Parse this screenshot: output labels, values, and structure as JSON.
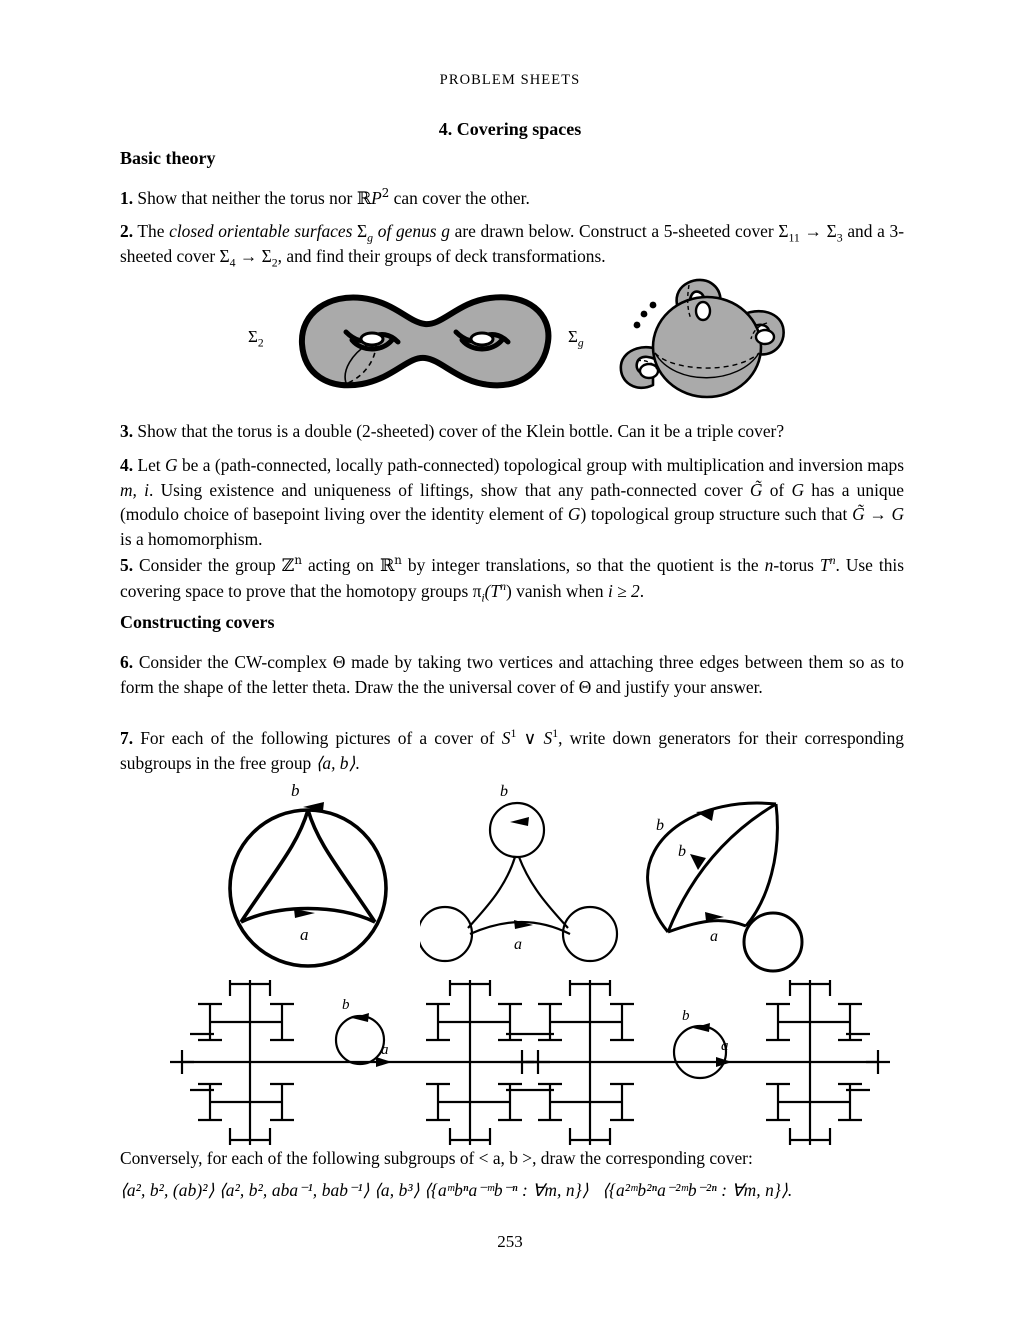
{
  "document": {
    "running_head": "PROBLEM SHEETS",
    "section_title": "4. Covering spaces",
    "page_number": "253"
  },
  "headings": {
    "basic_theory": "Basic theory",
    "constructing_covers": "Constructing covers"
  },
  "problems": {
    "p1": {
      "number": "1.",
      "text_a": "Show that neither the torus nor ",
      "math_rp2": "RP",
      "sup_2": "2",
      "text_b": " can cover the other."
    },
    "p2": {
      "number": "2.",
      "text_a": "The ",
      "italic_a": "closed orientable surfaces",
      "sigma": "Σ",
      "sub_g": "g",
      "italic_b": "of genus",
      "g": "g",
      "text_b": " are drawn below.  Construct a 5-sheeted cover ",
      "sigma11": "Σ",
      "sub_11": "11",
      "arrow": "→",
      "sigma3": "Σ",
      "sub_3": "3",
      "text_c": " and a 3-sheeted cover ",
      "sigma4": "Σ",
      "sub_4": "4",
      "sigma2": "Σ",
      "sub_2": "2",
      "text_d": ", and find their groups of deck transformations."
    },
    "p3": {
      "number": "3.",
      "text": "Show that the torus is a double (2-sheeted) cover of the Klein bottle.  Can it be a triple cover?"
    },
    "p4": {
      "number": "4.",
      "text_a": "Let ",
      "G": "G",
      "text_b": " be a (path-connected, locally path-connected) topological group with multiplication and inversion maps ",
      "m_i": "m, i",
      "text_c": ". Using existence and uniqueness of liftings, show that any path-connected cover ",
      "Gtilde": "G̃",
      "text_d": " of ",
      "G2": "G",
      "text_e": " has a unique (modulo choice of basepoint living over the identity element of ",
      "G3": "G",
      "text_f": ") topological group structure such that ",
      "Gtilde2": "G̃",
      "arrow": " → ",
      "G4": "G",
      "text_g": " is a homomorphism."
    },
    "p5": {
      "number": "5.",
      "text_a": "Consider the group ",
      "Zn": "Z",
      "sup_n1": "n",
      "text_b": " acting on ",
      "Rn": "R",
      "sup_n2": "n",
      "text_c": " by integer translations, so that the quotient is the ",
      "ntorus": "n",
      "text_d": "-torus ",
      "Tn": "T",
      "sup_n3": "n",
      "text_e": ". Use this covering space to prove that the homotopy groups ",
      "pi": "π",
      "sub_i": "i",
      "paren_tn": "(T",
      "sup_n4": "n",
      "paren_close": ")",
      "text_f": " vanish when ",
      "cond": "i ≥ 2",
      "text_g": "."
    },
    "p6": {
      "number": "6.",
      "text_a": "Consider the CW-complex ",
      "theta1": "Θ",
      "text_b": " made by taking two vertices and attaching three edges between them so as to form the shape of the letter theta.  Draw the the universal cover of ",
      "theta2": "Θ",
      "text_c": " and justify your answer."
    },
    "p7": {
      "number": "7.",
      "text_a": "For each of the following pictures of a cover of ",
      "S1a": "S",
      "sup_1a": "1",
      "vee": " ∨ ",
      "S1b": "S",
      "sup_1b": "1",
      "text_b": ", write down generators for their corresponding subgroups in the free group ",
      "free_group": "⟨a, b⟩",
      "text_c": "."
    }
  },
  "closing": {
    "conversely": "Conversely, for each of the following subgroups of < a, b >, draw the corresponding cover:",
    "subgroups": [
      "⟨a², b², (ab)²⟩",
      "⟨a², b², aba⁻¹, bab⁻¹⟩",
      "⟨a, b³⟩",
      "⟨{aᵐbⁿa⁻ᵐb⁻ⁿ : ∀m, n}⟩",
      "⟨{a²ᵐb²ⁿa⁻²ᵐb⁻²ⁿ : ∀m, n}⟩."
    ]
  },
  "figures": {
    "surfaces": {
      "left_label": "Σ",
      "left_sub": "2",
      "right_label": "Σ",
      "right_sub": "g",
      "fill_color": "#aaaaaa",
      "stroke_color": "#000000",
      "caption_left": "genus 2 closed orientable surface",
      "caption_right": "genus g closed orientable surface with dots indicating more handles"
    },
    "covers_row1": [
      {
        "name": "three-fold-cover-disk",
        "edge_labels": [
          "b",
          "a"
        ],
        "description": "circle with inscribed triangle, 3-sheeted cover"
      },
      {
        "name": "theta-like-cover",
        "edge_labels": [
          "b",
          "a"
        ],
        "description": "three loops joined by arcs"
      },
      {
        "name": "two-vertex-cover",
        "edge_labels": [
          "b",
          "b",
          "a"
        ],
        "description": "bigon with two b edges, an a edge and a loop"
      }
    ],
    "covers_row2": [
      {
        "name": "cayley-tree-left",
        "edge_labels": [
          "b",
          "a"
        ],
        "description": "two Cayley-graph trees joined by an a edge with a b loop"
      },
      {
        "name": "cayley-tree-right",
        "edge_labels": [
          "b",
          "a"
        ],
        "description": "two Cayley-graph trees joined by an a edge with a b loop"
      }
    ]
  }
}
